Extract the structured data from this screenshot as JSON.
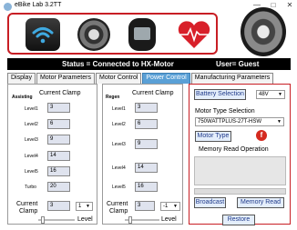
{
  "window": {
    "title": "eBike Lab 3.2TT",
    "minimize_icon": "minimize-icon",
    "maximize_icon": "maximize-icon",
    "close_icon": "close-icon"
  },
  "header_icons": [
    "wifi-icon",
    "hub-motor-icon",
    "lcd-display-icon",
    "heart-rate-icon",
    "large-hub-motor-icon"
  ],
  "status": {
    "text": "Status = Connected to HX-Motor",
    "user": "User= Guest"
  },
  "tabs": [
    {
      "label": "Display",
      "active": false
    },
    {
      "label": "Motor Parameters",
      "active": false
    },
    {
      "label": "Motor Control",
      "active": false
    },
    {
      "label": "Power Control",
      "active": true
    },
    {
      "label": "Manufacturing Parameters",
      "active": false
    }
  ],
  "assisting": {
    "section_label": "Assisting",
    "header": "Current Clamp",
    "levels": [
      {
        "label": "Level1",
        "value": "3"
      },
      {
        "label": "Level2",
        "value": "6"
      },
      {
        "label": "Level3",
        "value": "9"
      },
      {
        "label": "Level4",
        "value": "14"
      },
      {
        "label": "Level5",
        "value": "16"
      },
      {
        "label": "Turbo",
        "value": "20"
      }
    ],
    "current_clamp_label_line1": "Current",
    "current_clamp_label_line2": "Clamp",
    "current_clamp_value": "3",
    "level_select": "1",
    "level_label": "Level"
  },
  "regen": {
    "section_label": "Regen",
    "header": "Current Clamp",
    "levels": [
      {
        "label": "Level1",
        "value": "3"
      },
      {
        "label": "Level2",
        "value": "6"
      },
      {
        "label": "Level3",
        "value": "9"
      },
      {
        "label": "Level4",
        "value": "14"
      },
      {
        "label": "Level5",
        "value": "16"
      }
    ],
    "current_clamp_label_line1": "Current",
    "current_clamp_label_line2": "Clamp",
    "current_clamp_value": "3",
    "level_select": "-1",
    "level_label": "Level"
  },
  "right": {
    "battery_button": "Battery Selection",
    "battery_value": "48V",
    "motor_type_selection_label": "Motor Type Selection",
    "motor_type_value": "750WATTPLUS-27T-HSW",
    "motor_type_button": "Motor Type",
    "motor_type_icon": "f",
    "memory_read_label": "Memory Read Operation",
    "broadcast_button": "Broadcast",
    "memory_read_button": "Memory Read",
    "restore_button": "Restore"
  },
  "colors": {
    "accent_red": "#c81e24",
    "tab_active": "#5aa0d6",
    "button_text": "#1f3a8a"
  }
}
